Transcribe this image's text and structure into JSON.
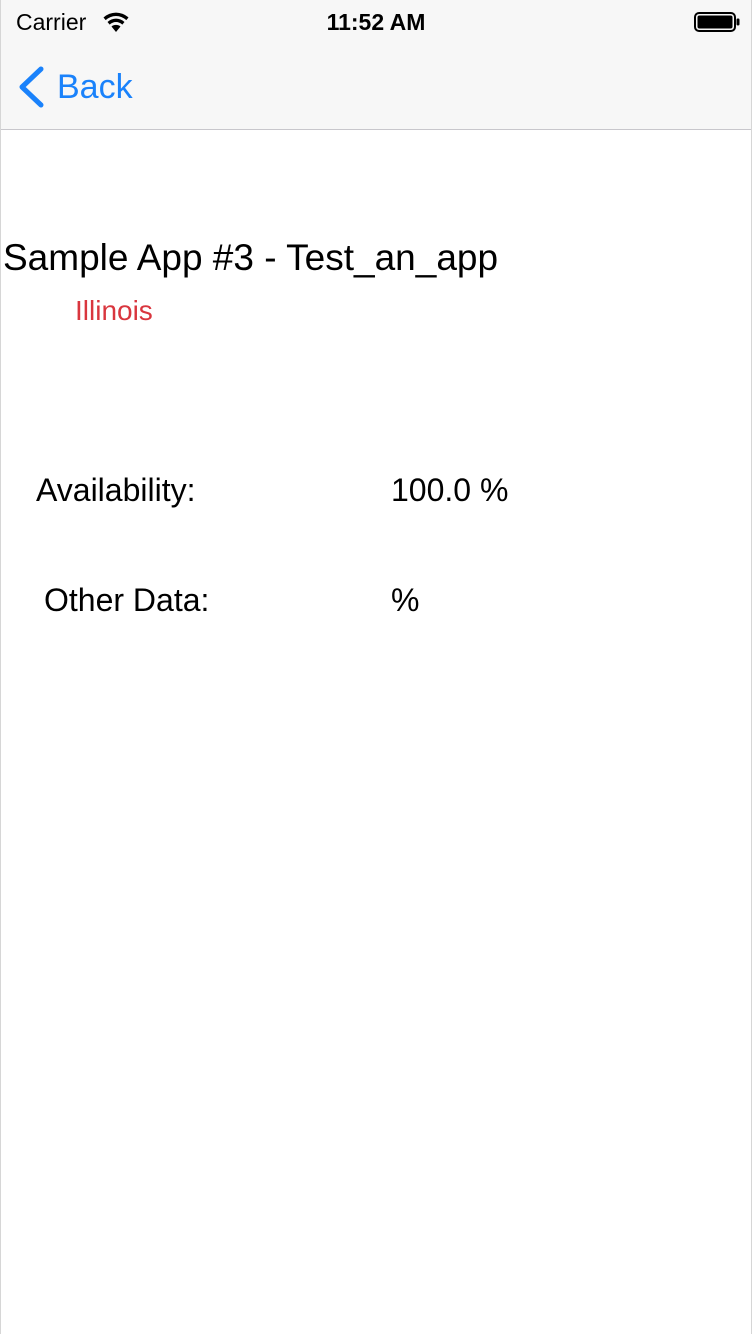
{
  "status_bar": {
    "carrier": "Carrier",
    "time": "11:52 AM",
    "wifi_icon": "wifi-icon",
    "battery_icon": "battery-full-icon"
  },
  "nav": {
    "back_label": "Back",
    "back_icon": "chevron-left-icon",
    "accent_color": "#1a82fb"
  },
  "detail": {
    "title": "Sample App #3 - Test_an_app",
    "region": "Illinois",
    "region_color": "#d9363e",
    "rows": [
      {
        "label": "Availability:",
        "value": "100.0 %"
      },
      {
        "label": "Other Data:",
        "value": "%"
      }
    ]
  }
}
